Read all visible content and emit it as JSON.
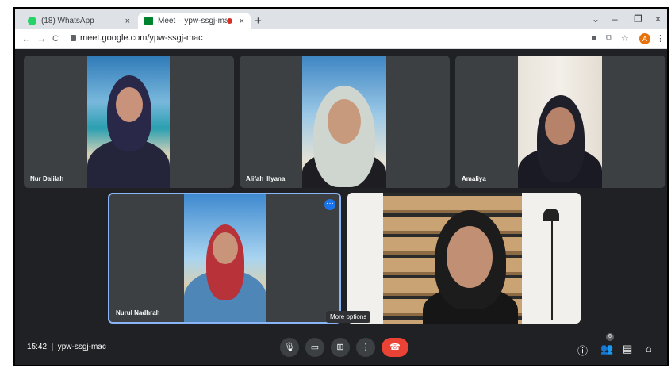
{
  "browser": {
    "tabs": [
      {
        "label": "(18) WhatsApp",
        "close": "×"
      },
      {
        "label": "Meet – ypw-ssgj-mac",
        "close": "×"
      }
    ],
    "new_tab": "+",
    "window_controls": [
      "⌄",
      "–",
      "❐",
      "×"
    ],
    "url": "meet.google.com/ypw-ssgj-mac",
    "nav": {
      "back": "←",
      "forward": "→",
      "reload": "C"
    },
    "avatar_letter": "A"
  },
  "participants": [
    {
      "name": "Nur Dalilah"
    },
    {
      "name": "Alifah Illyana"
    },
    {
      "name": "Amaliya"
    },
    {
      "name": "Nurul Nadhrah"
    },
    {
      "name": ""
    }
  ],
  "tooltip": "More options",
  "bottom_bar": {
    "time": "15:42",
    "meeting_code": "ypw-ssgj-mac",
    "people_count": "6",
    "icons": [
      "mic-icon",
      "camera-icon",
      "present-icon",
      "more-options-icon",
      "hang-up-icon",
      "info-icon",
      "people-icon",
      "chat-icon",
      "activities-icon"
    ]
  },
  "colors": {
    "background": "#202124",
    "tile": "#3c4043",
    "hang_up": "#ea4335",
    "highlight": "#8ab4f8"
  }
}
